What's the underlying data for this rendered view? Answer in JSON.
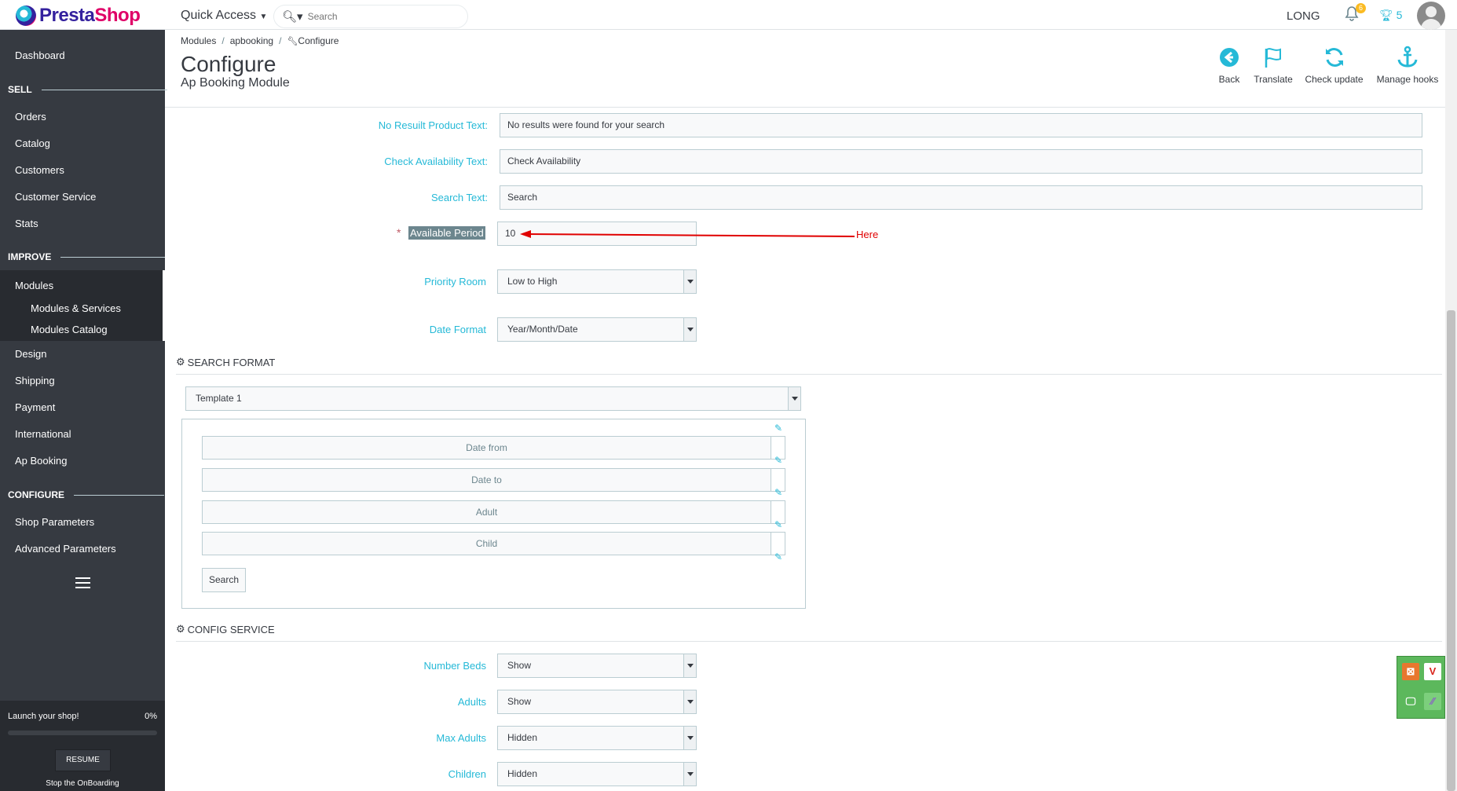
{
  "topbar": {
    "logo_text_part1": "Presta",
    "logo_text_part2": "Shop",
    "quick_access": "Quick Access",
    "search_placeholder": "Search",
    "shop_name": "LONG",
    "notifications_count": "6",
    "trophy_count": "5"
  },
  "sidebar": {
    "dashboard": "Dashboard",
    "sell": "SELL",
    "orders": "Orders",
    "catalog": "Catalog",
    "customers": "Customers",
    "customer_service": "Customer Service",
    "stats": "Stats",
    "improve": "IMPROVE",
    "modules": "Modules",
    "modules_services": "Modules & Services",
    "modules_catalog": "Modules Catalog",
    "design": "Design",
    "shipping": "Shipping",
    "payment": "Payment",
    "international": "International",
    "ap_booking": "Ap Booking",
    "configure": "CONFIGURE",
    "shop_parameters": "Shop Parameters",
    "advanced_parameters": "Advanced Parameters",
    "launch_text": "Launch your shop!",
    "launch_pct": "0%",
    "launch_progress": 0,
    "resume": "RESUME",
    "stop_onboarding": "Stop the OnBoarding"
  },
  "header": {
    "breadcrumb": [
      "Modules",
      "apbooking",
      "Configure"
    ],
    "title": "Configure",
    "subtitle": "Ap Booking Module",
    "toolbar": {
      "back": "Back",
      "translate": "Translate",
      "check_update": "Check update",
      "manage_hooks": "Manage hooks"
    }
  },
  "form": {
    "no_result_label": "No Resuilt Product Text:",
    "no_result_value": "No results were found for your search",
    "check_avail_label": "Check Availability Text:",
    "check_avail_value": "Check Availability",
    "search_text_label": "Search Text:",
    "search_text_value": "Search",
    "available_period_label": "Available Period",
    "available_period_value": "10",
    "annotation": "Here",
    "priority_room_label": "Priority Room",
    "priority_room_value": "Low to High",
    "date_format_label": "Date Format",
    "date_format_value": "Year/Month/Date"
  },
  "search_format": {
    "heading": "SEARCH FORMAT",
    "template": "Template 1",
    "fields": [
      "Date from",
      "Date to",
      "Adult",
      "Child"
    ],
    "search_button": "Search"
  },
  "config_service": {
    "heading": "CONFIG SERVICE",
    "number_beds_label": "Number Beds",
    "number_beds_value": "Show",
    "adults_label": "Adults",
    "adults_value": "Show",
    "max_adults_label": "Max Adults",
    "max_adults_value": "Hidden",
    "children_label": "Children",
    "children_value": "Hidden"
  },
  "colors": {
    "sidebar_bg": "#363a41",
    "accent": "#25b9d7",
    "annotation": "#e00000"
  }
}
